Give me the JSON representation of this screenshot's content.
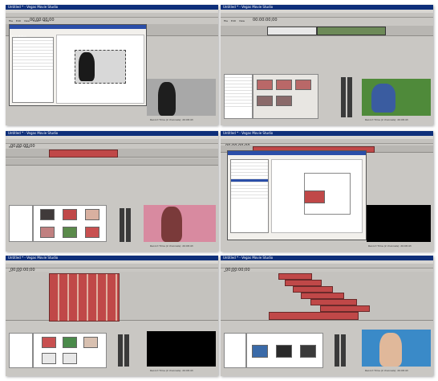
{
  "panels": [
    {
      "title": "Untitled * - Vegas Movie Studio",
      "timecode": "00:00:00;00",
      "menu": [
        "File",
        "Edit",
        "View",
        "Insert",
        "Tools",
        "Options",
        "Help"
      ],
      "dialog_title": "Track Motion",
      "status": "Record Time (2 channels): 20:08:43"
    },
    {
      "title": "Untitled * - Vegas Movie Studio",
      "timecode": "00:00:00;00",
      "menu": [
        "File",
        "Edit",
        "View",
        "Insert",
        "Tools",
        "Options",
        "Help"
      ],
      "status": "Record Time (2 channels): 20:08:43"
    },
    {
      "title": "Untitled * - Vegas Movie Studio",
      "timecode": "00:00:00;00",
      "menu": [
        "File",
        "Edit",
        "View",
        "Insert",
        "Tools",
        "Options",
        "Help"
      ],
      "status": "Record Time (2 channels): 20:08:43"
    },
    {
      "title": "Untitled * - Vegas Movie Studio",
      "timecode": "00:00:00;00",
      "menu": [
        "File",
        "Edit",
        "View",
        "Insert",
        "Tools",
        "Options",
        "Help"
      ],
      "dialog_title": "Event Pan/Crop",
      "status": "Record Time (2 channels): 20:08:43"
    },
    {
      "title": "Untitled * - Vegas Movie Studio",
      "timecode": "00:00:00;00",
      "menu": [
        "File",
        "Edit",
        "View",
        "Insert",
        "Tools",
        "Options",
        "Help"
      ],
      "status": "Record Time (2 channels): 20:08:43"
    },
    {
      "title": "Untitled * - Vegas Movie Studio",
      "timecode": "00:00:00;00",
      "menu": [
        "File",
        "Edit",
        "View",
        "Insert",
        "Tools",
        "Options",
        "Help"
      ],
      "status": "Record Time (2 channels): 20:08:43"
    }
  ],
  "tabs": [
    "Media Pool",
    "Explorer",
    "Transitions",
    "Video FX",
    "Media Generators"
  ],
  "colors": {
    "titlebar": "#0e2f7a",
    "clip_red": "#c04848",
    "clip_pink": "#d9a0a8",
    "workspace": "#c9c7c3"
  }
}
